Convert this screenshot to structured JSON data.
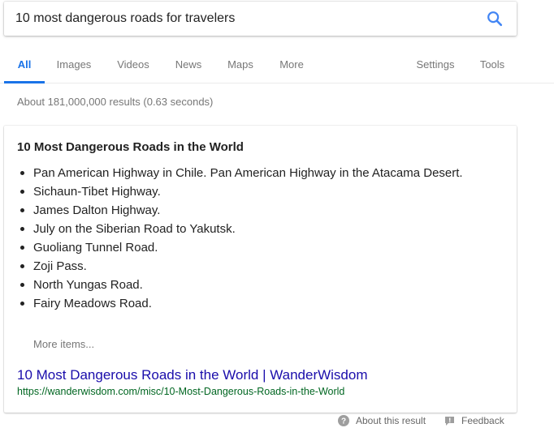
{
  "search": {
    "query": "10 most dangerous roads for travelers",
    "icon": "search-icon"
  },
  "tabs": {
    "items": [
      {
        "label": "All",
        "active": true
      },
      {
        "label": "Images"
      },
      {
        "label": "Videos"
      },
      {
        "label": "News"
      },
      {
        "label": "Maps"
      },
      {
        "label": "More"
      }
    ],
    "settings": "Settings",
    "tools": "Tools"
  },
  "results_stats": "About 181,000,000 results (0.63 seconds)",
  "snippet": {
    "title": "10 Most Dangerous Roads in the World",
    "items": [
      "Pan American Highway in Chile. Pan American Highway in the Atacama Desert.",
      "Sichaun-Tibet Highway.",
      "James Dalton Highway.",
      "July on the Siberian Road to Yakutsk.",
      "Guoliang Tunnel Road.",
      "Zoji Pass.",
      "North Yungas Road.",
      "Fairy Meadows Road."
    ],
    "more_items": "More items...",
    "link_title": "10 Most Dangerous Roads in the World | WanderWisdom",
    "link_url": "https://wanderwisdom.com/misc/10-Most-Dangerous-Roads-in-the-World"
  },
  "footer": {
    "about": "About this result",
    "feedback": "Feedback"
  },
  "colors": {
    "accent": "#1a73e8",
    "link": "#1a0dab",
    "url": "#006621",
    "muted": "#777777"
  }
}
